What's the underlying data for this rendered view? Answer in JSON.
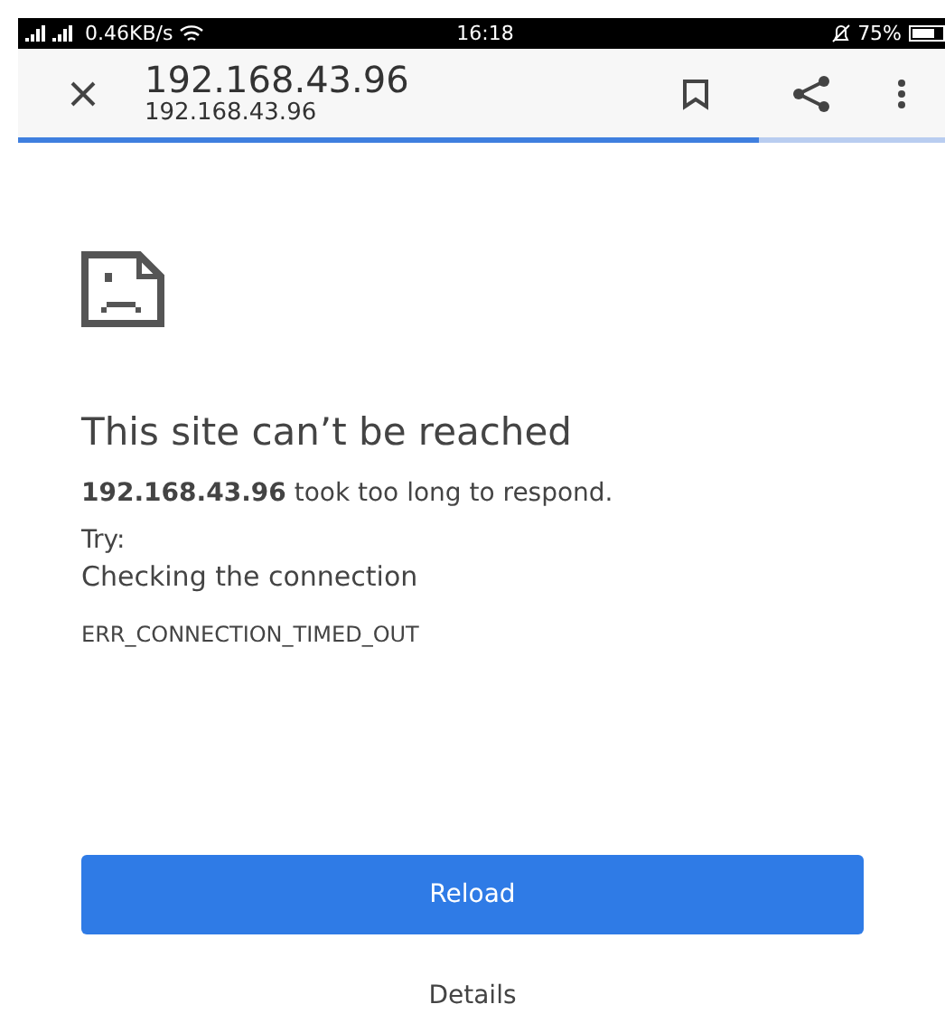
{
  "status_bar": {
    "speed": "0.46KB/s",
    "time": "16:18",
    "battery": "75%"
  },
  "toolbar": {
    "title": "192.168.43.96",
    "url": "192.168.43.96"
  },
  "progress": {
    "level": 0.8
  },
  "error": {
    "title": "This site can’t be reached",
    "message": "**192.168.43.96** took too long to respond.",
    "try_label": "Try:",
    "suggestion": "Checking the connection",
    "code": "ERR_CONNECTION_TIMED_OUT"
  },
  "buttons": {
    "reload": "Reload",
    "details": "Details"
  }
}
